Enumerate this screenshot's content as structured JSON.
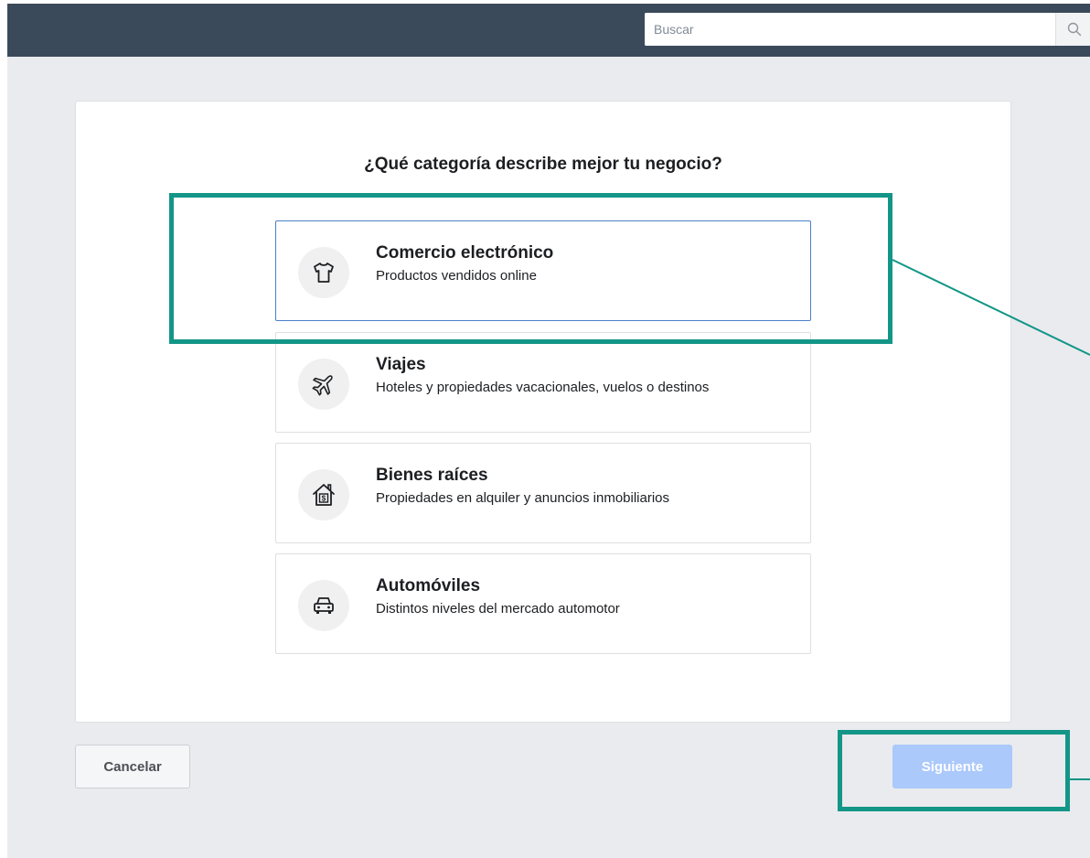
{
  "topbar": {
    "search": {
      "placeholder": "Buscar",
      "value": ""
    },
    "search_icon": "search-icon"
  },
  "main": {
    "question": "¿Qué categoría describe mejor tu negocio?",
    "options": [
      {
        "title": "Comercio electrónico",
        "subtitle": "Productos vendidos online",
        "icon": "tshirt-icon",
        "selected": true
      },
      {
        "title": "Viajes",
        "subtitle": "Hoteles y propiedades vacacionales, vuelos o destinos",
        "icon": "airplane-icon",
        "selected": false
      },
      {
        "title": "Bienes raíces",
        "subtitle": "Propiedades en alquiler y anuncios inmobiliarios",
        "icon": "house-dollar-icon",
        "selected": false
      },
      {
        "title": "Automóviles",
        "subtitle": "Distintos niveles del mercado automotor",
        "icon": "car-icon",
        "selected": false
      }
    ]
  },
  "footer": {
    "cancel_label": "Cancelar",
    "next_label": "Siguiente",
    "next_disabled": true
  },
  "colors": {
    "topbar": "#3b4a5a",
    "selected_border": "#4a80c7",
    "next_button_disabled": "#abc9fb",
    "annotation": "#139687"
  }
}
